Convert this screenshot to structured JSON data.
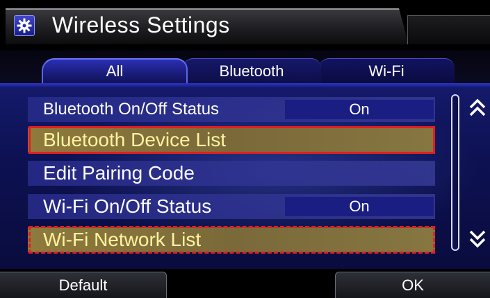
{
  "header": {
    "title": "Wireless Settings",
    "icon": "gear-icon"
  },
  "tabs": [
    {
      "label": "All",
      "active": true
    },
    {
      "label": "Bluetooth",
      "active": false
    },
    {
      "label": "Wi-Fi",
      "active": false
    }
  ],
  "list": {
    "items": [
      {
        "label": "Bluetooth On/Off Status",
        "value": "On"
      },
      {
        "label": "Bluetooth Device List",
        "highlight": "solid"
      },
      {
        "label": "Edit Pairing Code"
      },
      {
        "label": "Wi-Fi On/Off Status",
        "value": "On"
      },
      {
        "label": "Wi-Fi Network List",
        "highlight": "dashed"
      }
    ]
  },
  "scroll": {
    "up_icon": "double-chevron-up-icon",
    "down_icon": "double-chevron-down-icon"
  },
  "footer": {
    "default_label": "Default",
    "ok_label": "OK"
  },
  "colors": {
    "accent": "#2a2fb0",
    "selected_row": "#8e7a3c",
    "highlight_border": "#e02020"
  }
}
